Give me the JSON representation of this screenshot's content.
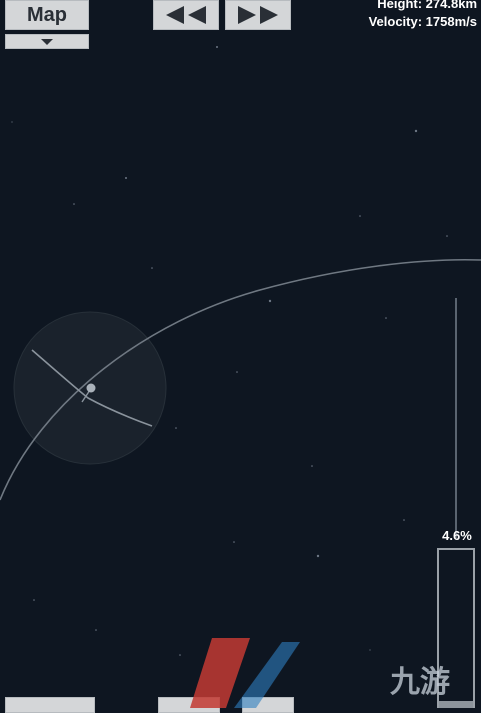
{
  "map_button": {
    "label": "Map"
  },
  "time_controls": {
    "rewind_icon": "rewind-icon",
    "fast_forward_icon": "fast-forward-icon"
  },
  "telemetry": {
    "height": "Height: 274.8km",
    "velocity": "Velocity: 1758m/s"
  },
  "throttle": {
    "label": "4.6%",
    "level": 0.046
  },
  "colors": {
    "background": "#0e1621",
    "button": "#d4d6d8",
    "orbit": "#6f7882"
  },
  "watermark": {
    "text": "九游"
  }
}
